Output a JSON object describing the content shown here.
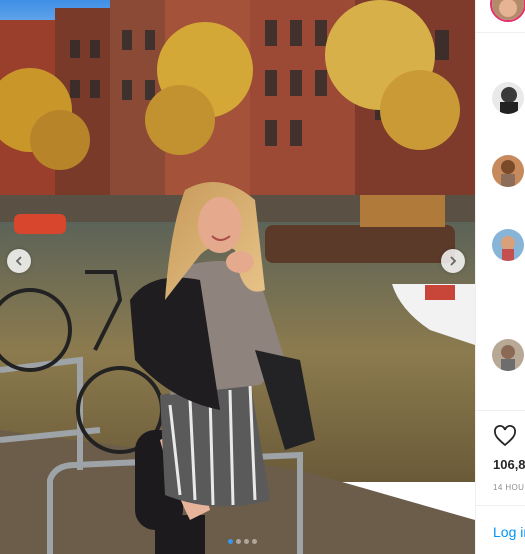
{
  "post": {
    "photo_alt": "Woman posing by a canal with autumn trees and boats in Amsterdam",
    "carousel": {
      "slides": 4,
      "active_index": 0
    }
  },
  "sidebar": {
    "likes_count": "106,8",
    "timestamp": "14 HOU",
    "login_label": "Log in"
  },
  "icons": {
    "prev": "chevron-left-icon",
    "next": "chevron-right-icon",
    "like": "heart-outline-icon"
  },
  "colors": {
    "accent_blue": "#3897f0",
    "link_blue": "#0095f6",
    "story_ring": "#e1306c"
  }
}
